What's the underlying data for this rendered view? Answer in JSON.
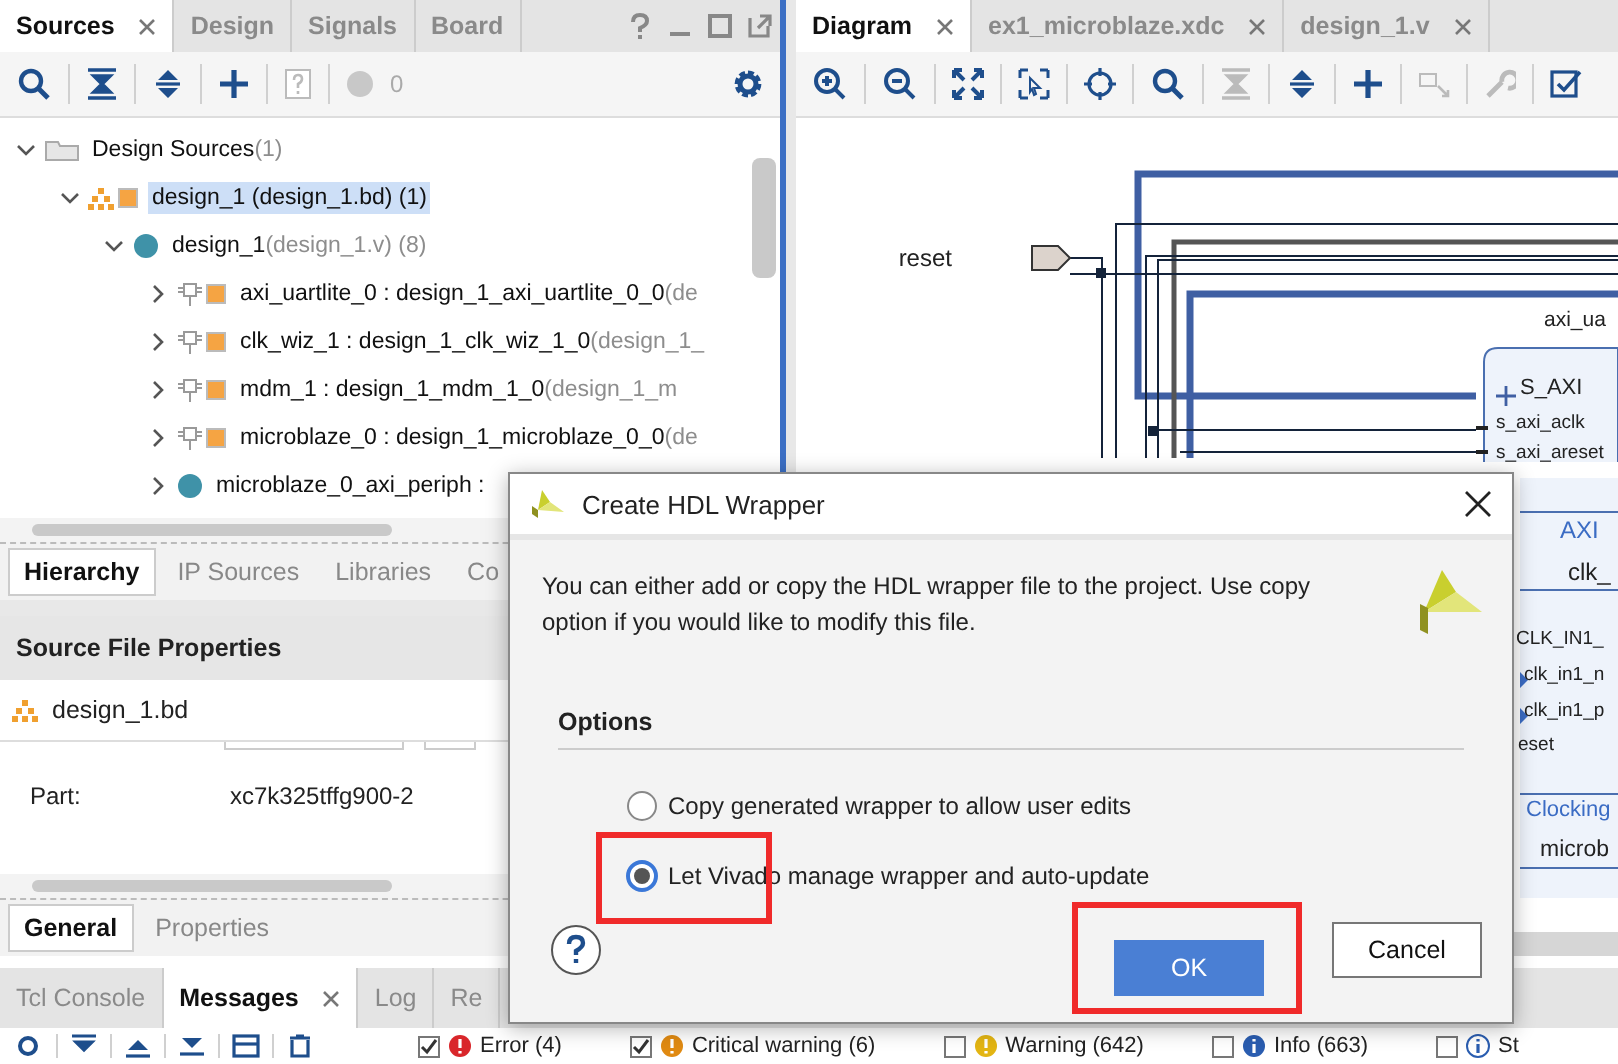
{
  "sources_panel": {
    "tabs": [
      {
        "label": "Sources",
        "selected": true
      },
      {
        "label": "Design",
        "selected": false
      },
      {
        "label": "Signals",
        "selected": false
      },
      {
        "label": "Board",
        "selected": false
      }
    ],
    "warning_count": "0",
    "tree": [
      {
        "label": "Design Sources",
        "note": "(1)",
        "kind": "folder",
        "expanded": true,
        "selected": false,
        "children": [
          {
            "label": "design_1 (design_1.bd) (1)",
            "kind": "block-design",
            "expanded": true,
            "selected": true,
            "children": [
              {
                "label": "design_1",
                "note": "(design_1.v) (8)",
                "kind": "module",
                "expanded": true,
                "selected": false,
                "children": [
                  {
                    "label": "axi_uartlite_0 : design_1_axi_uartlite_0_0",
                    "note": "(de",
                    "kind": "ip",
                    "expanded": false,
                    "selected": false
                  },
                  {
                    "label": "clk_wiz_1 : design_1_clk_wiz_1_0",
                    "note": "(design_1_",
                    "kind": "ip",
                    "expanded": false,
                    "selected": false
                  },
                  {
                    "label": "mdm_1 : design_1_mdm_1_0",
                    "note": "(design_1_m",
                    "kind": "ip",
                    "expanded": false,
                    "selected": false
                  },
                  {
                    "label": "microblaze_0 : design_1_microblaze_0_0",
                    "note": "(de",
                    "kind": "ip",
                    "expanded": false,
                    "selected": false
                  },
                  {
                    "label": "microblaze_0_axi_periph :",
                    "kind": "module",
                    "expanded": false,
                    "selected": false
                  }
                ]
              }
            ]
          }
        ]
      }
    ],
    "view_tabs": [
      {
        "label": "Hierarchy",
        "selected": true
      },
      {
        "label": "IP Sources",
        "selected": false
      },
      {
        "label": "Libraries",
        "selected": false
      },
      {
        "label": "Co",
        "selected": false
      }
    ]
  },
  "properties_panel": {
    "title": "Source File Properties",
    "file": "design_1.bd",
    "fields": [
      {
        "label": "Part:",
        "value": "xc7k325tffg900-2"
      }
    ],
    "tabs": [
      {
        "label": "General",
        "selected": true
      },
      {
        "label": "Properties",
        "selected": false
      }
    ]
  },
  "diagram_panel": {
    "tabs": [
      {
        "label": "Diagram",
        "selected": true
      },
      {
        "label": "ex1_microblaze.xdc",
        "selected": false
      },
      {
        "label": "design_1.v",
        "selected": false
      }
    ],
    "port": "reset",
    "labels": [
      "axi_ua",
      "S_AXI",
      "s_axi_aclk",
      "s_axi_areset",
      "AXI",
      "clk_",
      "CLK_IN1_",
      "clk_in1_n",
      "clk_in1_p",
      "eset",
      "Clocking",
      "microb"
    ]
  },
  "messages_panel": {
    "tabs": [
      {
        "label": "Tcl Console",
        "selected": false
      },
      {
        "label": "Messages",
        "selected": true
      },
      {
        "label": "Log",
        "selected": false
      },
      {
        "label": "Re",
        "selected": false
      }
    ],
    "filters": [
      {
        "label": "Error (4)",
        "checked": true,
        "kind": "error"
      },
      {
        "label": "Critical warning (6)",
        "checked": true,
        "kind": "critical"
      },
      {
        "label": "Warning (642)",
        "checked": false,
        "kind": "warning"
      },
      {
        "label": "Info (663)",
        "checked": false,
        "kind": "info"
      },
      {
        "label": "St",
        "checked": false,
        "kind": "status"
      }
    ]
  },
  "dialog": {
    "title": "Create HDL Wrapper",
    "message": "You can either add or copy the HDL wrapper file to the project. Use copy option if you would like to modify this file.",
    "section": "Options",
    "options": [
      {
        "label": "Copy generated wrapper to allow user edits",
        "selected": false,
        "highlighted": false
      },
      {
        "label": "Let Vivado manage wrapper and auto-update",
        "selected": true,
        "highlighted": true
      }
    ],
    "buttons": [
      {
        "label": "OK",
        "kind": "primary",
        "highlighted": true
      },
      {
        "label": "Cancel",
        "kind": "secondary",
        "highlighted": false
      }
    ]
  }
}
